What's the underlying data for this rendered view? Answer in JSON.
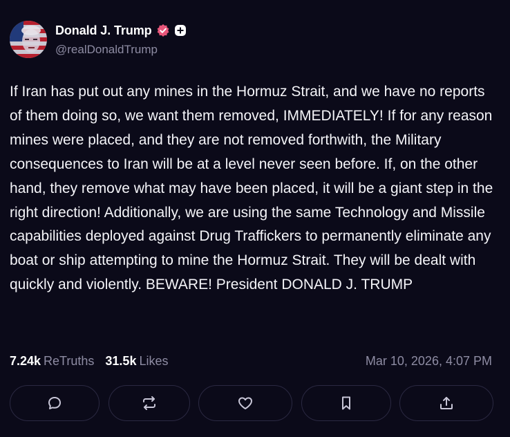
{
  "author": {
    "display_name": "Donald J. Trump",
    "handle": "@realDonaldTrump"
  },
  "post": {
    "text": "If Iran has put out any mines in the Hormuz Strait, and we have no reports of them doing so, we want them removed, IMMEDIATELY! If for any reason mines were placed, and they are not removed forthwith, the Military consequences to Iran will be at a level never seen before. If, on the other hand, they remove what may have been placed, it will be a giant step in the right direction! Additionally, we are using the same Technology and Missile capabilities deployed against Drug Traffickers to permanently eliminate any boat or ship attempting to mine the Hormuz Strait. They will be dealt with quickly and violently. BEWARE! President DONALD J. TRUMP"
  },
  "stats": {
    "retruths_count": "7.24k",
    "retruths_label": "ReTruths",
    "likes_count": "31.5k",
    "likes_label": "Likes",
    "timestamp": "Mar 10, 2026, 4:07 PM"
  },
  "actions": [
    {
      "icon": "comment-icon"
    },
    {
      "icon": "retruth-icon"
    },
    {
      "icon": "heart-icon"
    },
    {
      "icon": "bookmark-icon"
    },
    {
      "icon": "share-icon"
    }
  ],
  "colors": {
    "background": "#0b0a19",
    "verified_badge": "#e8567a",
    "muted_text": "#8e8ca3",
    "button_border": "#2b2942"
  }
}
